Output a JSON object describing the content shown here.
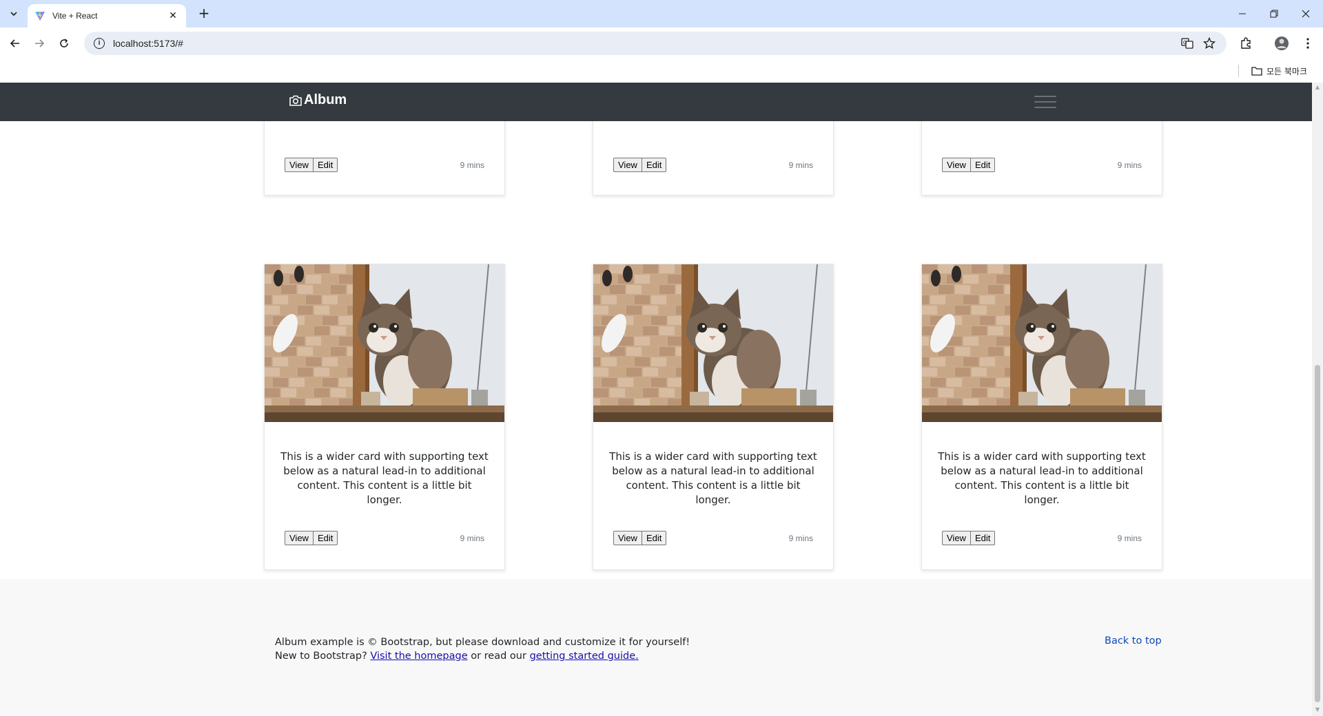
{
  "browser": {
    "tab_title": "Vite + React",
    "url": "localhost:5173/#",
    "bookmarks_all": "모든 북마크"
  },
  "navbar": {
    "brand": "Album",
    "brand_icon": "camera-icon"
  },
  "cards_top_row": [
    {
      "view": "View",
      "edit": "Edit",
      "time": "9 mins"
    },
    {
      "view": "View",
      "edit": "Edit",
      "time": "9 mins"
    },
    {
      "view": "View",
      "edit": "Edit",
      "time": "9 mins"
    }
  ],
  "cards_bottom_row": [
    {
      "text": "This is a wider card with supporting text below as a natural lead-in to additional content. This content is a little bit longer.",
      "view": "View",
      "edit": "Edit",
      "time": "9 mins"
    },
    {
      "text": "This is a wider card with supporting text below as a natural lead-in to additional content. This content is a little bit longer.",
      "view": "View",
      "edit": "Edit",
      "time": "9 mins"
    },
    {
      "text": "This is a wider card with supporting text below as a natural lead-in to additional content. This content is a little bit longer.",
      "view": "View",
      "edit": "Edit",
      "time": "9 mins"
    }
  ],
  "footer": {
    "line1": "Album example is © Bootstrap, but please download and customize it for yourself!",
    "line2_prefix": "New to Bootstrap? ",
    "homepage_link": "Visit the homepage",
    "line2_middle": " or read our ",
    "guide_link": "getting started guide.",
    "back_to_top": "Back to top"
  },
  "colors": {
    "navbar_bg": "#343a40",
    "footer_bg": "#f8f8f8",
    "link": "#1a0dab",
    "tabstrip": "#d3e3fd"
  }
}
